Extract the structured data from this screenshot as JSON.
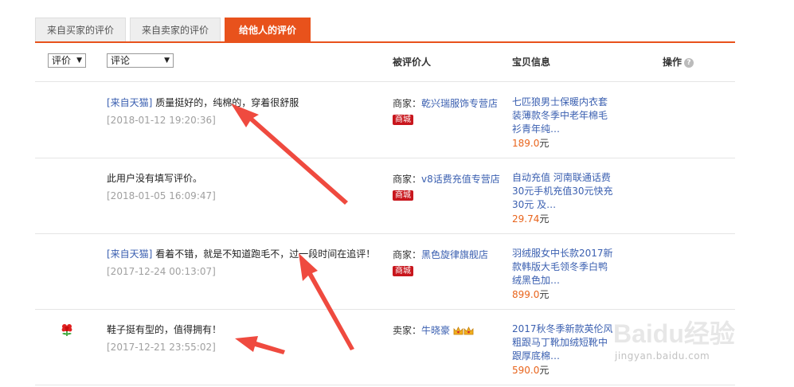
{
  "tabs": [
    {
      "label": "来自买家的评价",
      "active": false
    },
    {
      "label": "来自卖家的评价",
      "active": false
    },
    {
      "label": "给他人的评价",
      "active": true
    }
  ],
  "filters": {
    "rating_select": "评价",
    "comment_select": "评论"
  },
  "columns": {
    "target": "被评价人",
    "item_info": "宝贝信息",
    "actions": "操作",
    "help_icon": "?"
  },
  "rows": [
    {
      "source": "[来自天猫]",
      "comment": "质量挺好的，纯棉的，穿着很舒服",
      "date": "[2018-01-12 19:20:36]",
      "role": "商家：",
      "shop": "乾兴瑞服饰专营店",
      "badge": "商城",
      "item": "七匹狼男士保暖内衣套装薄款冬季中老年棉毛衫青年纯…",
      "price": "189.0",
      "currency": "元"
    },
    {
      "source": "",
      "comment": "此用户没有填写评价。",
      "date": "[2018-01-05 16:09:47]",
      "role": "商家：",
      "shop": "v8话费充值专营店",
      "badge": "商城",
      "item": "自动充值 河南联通话费30元手机充值30元快充30元 及…",
      "price": "29.74",
      "currency": "元"
    },
    {
      "source": "[来自天猫]",
      "comment": "看着不错，就是不知道跑毛不，过一段时间在追评！",
      "date": "[2017-12-24 00:13:07]",
      "role": "商家：",
      "shop": "黑色旋律旗舰店",
      "badge": "商城",
      "item": "羽绒服女中长款2017新款韩版大毛领冬季白鸭绒黑色加…",
      "price": "899.0",
      "currency": "元"
    },
    {
      "source": "",
      "comment": "鞋子挺有型的，值得拥有！",
      "date": "[2017-12-21 23:55:02]",
      "role": "卖家：",
      "shop": "牛晓豪",
      "badge": "",
      "item": "2017秋冬季新款英伦风粗跟马丁靴加绒短靴中跟厚底棉…",
      "price": "590.0",
      "currency": "元"
    }
  ],
  "watermark": {
    "brand": "Baidu经验",
    "url": "jingyan.baidu.com"
  },
  "colors": {
    "accent": "#e8521c",
    "link": "#3a5fb0",
    "price": "#e8641c",
    "badge": "#c8161d",
    "arrow": "#ef4a3f"
  }
}
